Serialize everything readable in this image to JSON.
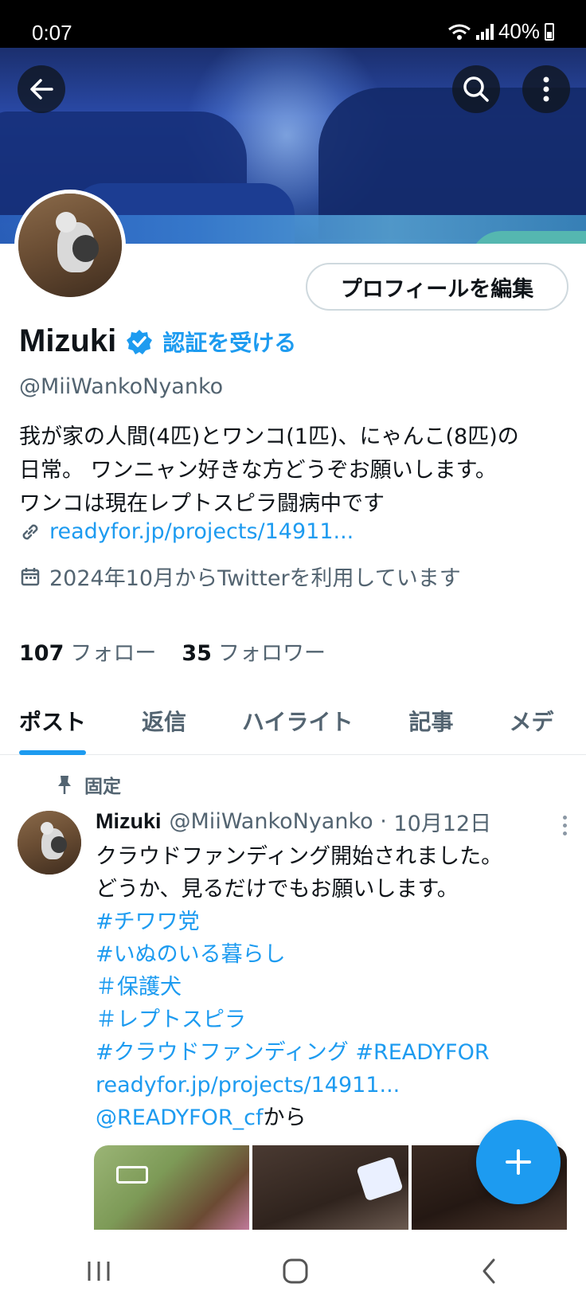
{
  "status_bar": {
    "time": "0:07",
    "battery": "40%"
  },
  "profile": {
    "edit_label": "プロフィールを編集",
    "name": "Mizuki",
    "verify_label": "認証を受ける",
    "handle": "@MiiWankoNyanko",
    "bio_lines": [
      "我が家の人間(4匹)とワンコ(1匹)、にゃんこ(8匹)の",
      "日常。 ワンニャン好きな方どうぞお願いします。",
      "ワンコは現在レプトスピラ闘病中です"
    ],
    "link": "readyfor.jp/projects/14911...",
    "joined": "2024年10月からTwitterを利用しています",
    "following_count": "107",
    "following_label": "フォロー",
    "followers_count": "35",
    "followers_label": "フォロワー"
  },
  "tabs": [
    {
      "label": "ポスト",
      "active": true
    },
    {
      "label": "返信",
      "active": false
    },
    {
      "label": "ハイライト",
      "active": false
    },
    {
      "label": "記事",
      "active": false
    },
    {
      "label": "メデ",
      "active": false
    }
  ],
  "post": {
    "pinned_label": "固定",
    "author_name": "Mizuki",
    "author_handle": "@MiiWankoNyanko",
    "date": "10月12日",
    "text_lines": [
      "クラウドファンディング開始されました。",
      "どうか、見るだけでもお願いします。"
    ],
    "hashtags": [
      "#チワワ党",
      "#いぬのいる暮らし",
      "＃保護犬",
      "＃レプトスピラ",
      "#クラウドファンディング #READYFOR"
    ],
    "link": "readyfor.jp/projects/14911...",
    "via_mention": "@READYFOR_cf",
    "via_suffix": "から"
  },
  "icons": {
    "back": "back-arrow-icon",
    "search": "search-icon",
    "more": "more-vertical-icon",
    "verified": "verified-badge-icon",
    "link": "link-icon",
    "calendar": "calendar-icon",
    "pin": "pin-icon",
    "compose": "plus-icon"
  },
  "colors": {
    "accent": "#1d9bf0",
    "text": "#0f1419",
    "secondary": "#536471"
  }
}
